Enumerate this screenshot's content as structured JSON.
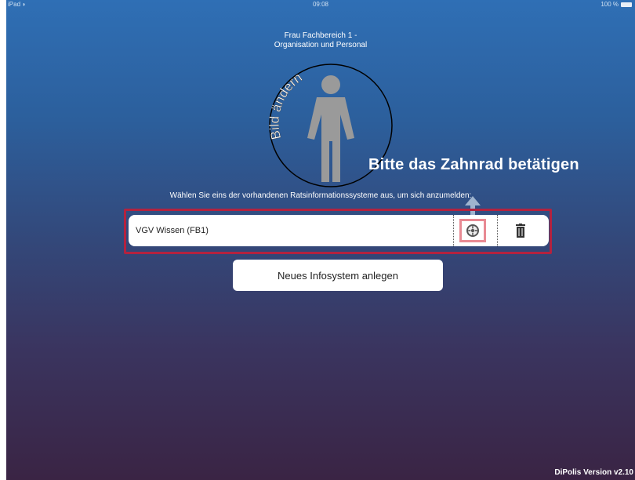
{
  "status_bar": {
    "device": "iPad",
    "wifi_icon": "wifi-icon",
    "time": "09:08",
    "battery": "100 %"
  },
  "profile": {
    "name_line1": "Frau Fachbereich 1 -",
    "name_line2": "Organisation und Personal",
    "change_picture_label": "Bild ändern"
  },
  "hint_overlay": "Bitte das Zahnrad betätigen",
  "instruction": "Wählen Sie eins der vorhandenen Ratsinformationssysteme aus, um sich anzumelden:",
  "systems": [
    {
      "name": "VGV Wissen (FB1)",
      "settings_icon": "gear-icon",
      "delete_icon": "trash-icon"
    }
  ],
  "new_system_button": "Neues Infosystem anlegen",
  "version": "DiPolis Version v2.10",
  "colors": {
    "highlight_frame": "#b3223f",
    "gear_highlight": "#e88a93",
    "background_top": "#2f6fb5",
    "background_bottom": "#3a2444"
  }
}
